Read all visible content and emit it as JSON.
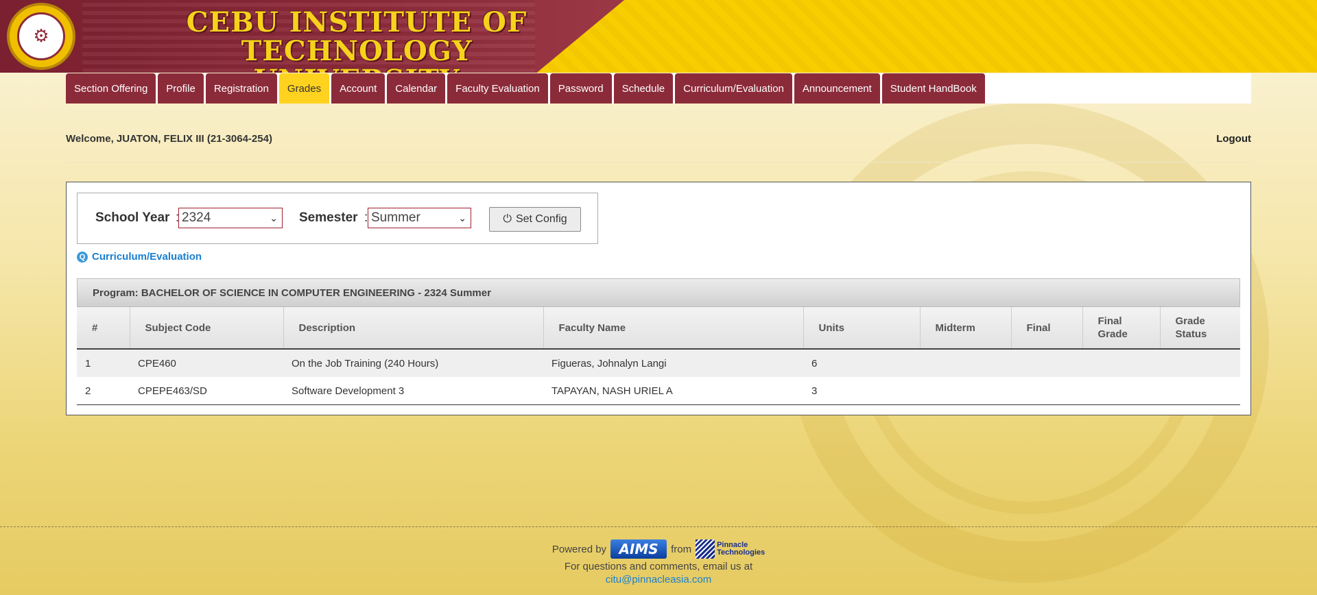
{
  "header": {
    "title_line1": "CEBU INSTITUTE OF TECHNOLOGY",
    "title_line2": "UNIVERSITY",
    "logo_icon": "university-seal-icon"
  },
  "nav": {
    "tabs": [
      {
        "label": "Section Offering"
      },
      {
        "label": "Profile"
      },
      {
        "label": "Registration"
      },
      {
        "label": "Grades",
        "active": true
      },
      {
        "label": "Account"
      },
      {
        "label": "Calendar"
      },
      {
        "label": "Faculty Evaluation"
      },
      {
        "label": "Password"
      },
      {
        "label": "Schedule"
      },
      {
        "label": "Curriculum/Evaluation"
      },
      {
        "label": "Announcement"
      },
      {
        "label": "Student HandBook"
      }
    ]
  },
  "user": {
    "welcome": "Welcome, JUATON, FELIX III (21-3064-254)",
    "logout": "Logout"
  },
  "config": {
    "school_year_label": "School Year",
    "school_year_value": "2324",
    "semester_label": "Semester",
    "semester_value": "Summer",
    "set_config_label": "Set Config",
    "colon": ":"
  },
  "curriculum_link": "Curriculum/Evaluation",
  "program": "Program: BACHELOR OF SCIENCE IN COMPUTER ENGINEERING - 2324 Summer",
  "table": {
    "headers": [
      "#",
      "Subject Code",
      "Description",
      "Faculty Name",
      "Units",
      "Midterm",
      "Final",
      "Final Grade",
      "Grade Status"
    ],
    "rows": [
      [
        "1",
        "CPE460",
        "On the Job Training (240 Hours)",
        "Figueras, Johnalyn Langi",
        "6",
        "",
        "",
        "",
        ""
      ],
      [
        "2",
        "CPEPE463/SD",
        "Software Development 3",
        "TAPAYAN, NASH URIEL A",
        "3",
        "",
        "",
        "",
        ""
      ]
    ]
  },
  "footer": {
    "powered_by": "Powered by",
    "aims_logo": "AIMS",
    "from": "from",
    "pinnacle_line1": "Pinnacle",
    "pinnacle_line2": "Technologies",
    "questions": "For questions and comments, email us at",
    "email": "citu@pinnacleasia.com"
  },
  "colors": {
    "maroon": "#8b2b3a",
    "gold": "#ffd21f",
    "link": "#1a7fd0"
  }
}
